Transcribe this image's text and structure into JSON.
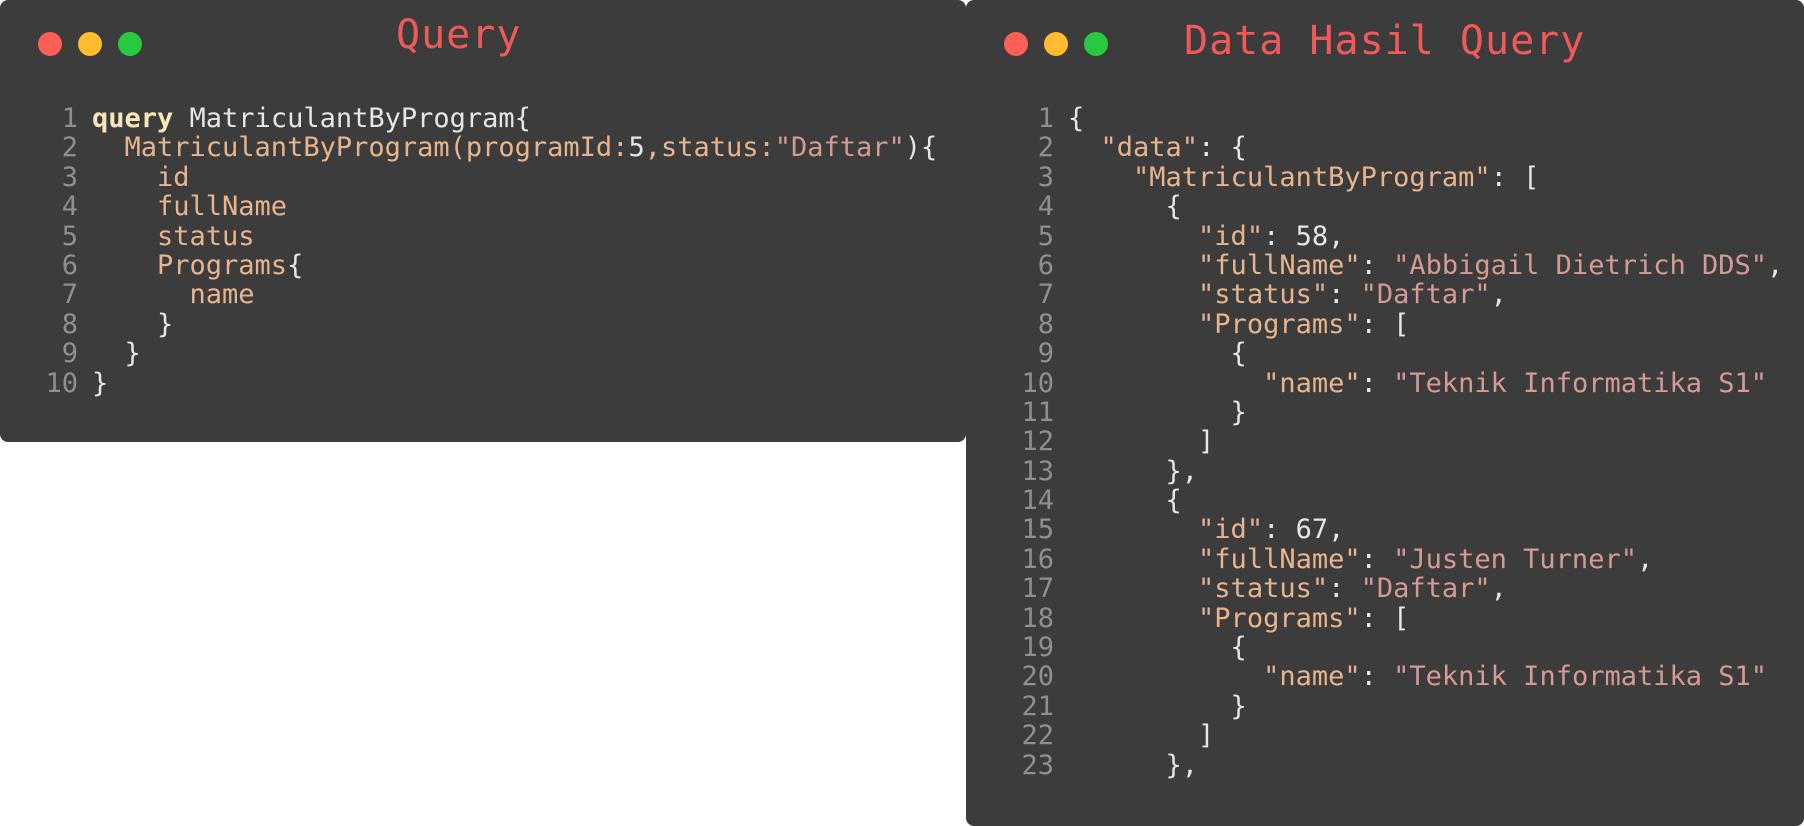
{
  "query_window": {
    "title": "Query",
    "lines": [
      {
        "n": "1",
        "tokens": [
          {
            "t": "query",
            "c": "kw"
          },
          {
            "t": " MatriculantByProgram{",
            "c": "txt"
          }
        ]
      },
      {
        "n": "2",
        "tokens": [
          {
            "t": "  MatriculantByProgram(programId:",
            "c": "fld"
          },
          {
            "t": "5",
            "c": "num"
          },
          {
            "t": ",status:",
            "c": "fld"
          },
          {
            "t": "\"Daftar\"",
            "c": "str"
          },
          {
            "t": "){",
            "c": "txt"
          }
        ]
      },
      {
        "n": "3",
        "tokens": [
          {
            "t": "    id",
            "c": "fld"
          }
        ]
      },
      {
        "n": "4",
        "tokens": [
          {
            "t": "    fullName",
            "c": "fld"
          }
        ]
      },
      {
        "n": "5",
        "tokens": [
          {
            "t": "    status",
            "c": "fld"
          }
        ]
      },
      {
        "n": "6",
        "tokens": [
          {
            "t": "    Programs",
            "c": "fld"
          },
          {
            "t": "{",
            "c": "txt"
          }
        ]
      },
      {
        "n": "7",
        "tokens": [
          {
            "t": "      name",
            "c": "fld"
          }
        ]
      },
      {
        "n": "8",
        "tokens": [
          {
            "t": "    }",
            "c": "txt"
          }
        ]
      },
      {
        "n": "9",
        "tokens": [
          {
            "t": "  }",
            "c": "txt"
          }
        ]
      },
      {
        "n": "10",
        "tokens": [
          {
            "t": "}",
            "c": "txt"
          }
        ]
      }
    ]
  },
  "result_window": {
    "title": "Data Hasil Query",
    "lines": [
      {
        "n": "1",
        "tokens": [
          {
            "t": "{",
            "c": "txt"
          }
        ]
      },
      {
        "n": "2",
        "tokens": [
          {
            "t": "  ",
            "c": "txt"
          },
          {
            "t": "\"data\"",
            "c": "key"
          },
          {
            "t": ": {",
            "c": "txt"
          }
        ]
      },
      {
        "n": "3",
        "tokens": [
          {
            "t": "    ",
            "c": "txt"
          },
          {
            "t": "\"MatriculantByProgram\"",
            "c": "key"
          },
          {
            "t": ": [",
            "c": "txt"
          }
        ]
      },
      {
        "n": "4",
        "tokens": [
          {
            "t": "      {",
            "c": "txt"
          }
        ]
      },
      {
        "n": "5",
        "tokens": [
          {
            "t": "        ",
            "c": "txt"
          },
          {
            "t": "\"id\"",
            "c": "key"
          },
          {
            "t": ": 58,",
            "c": "txt"
          }
        ]
      },
      {
        "n": "6",
        "tokens": [
          {
            "t": "        ",
            "c": "txt"
          },
          {
            "t": "\"fullName\"",
            "c": "key"
          },
          {
            "t": ": ",
            "c": "txt"
          },
          {
            "t": "\"Abbigail Dietrich DDS\"",
            "c": "str"
          },
          {
            "t": ",",
            "c": "txt"
          }
        ]
      },
      {
        "n": "7",
        "tokens": [
          {
            "t": "        ",
            "c": "txt"
          },
          {
            "t": "\"status\"",
            "c": "key"
          },
          {
            "t": ": ",
            "c": "txt"
          },
          {
            "t": "\"Daftar\"",
            "c": "str"
          },
          {
            "t": ",",
            "c": "txt"
          }
        ]
      },
      {
        "n": "8",
        "tokens": [
          {
            "t": "        ",
            "c": "txt"
          },
          {
            "t": "\"Programs\"",
            "c": "key"
          },
          {
            "t": ": [",
            "c": "txt"
          }
        ]
      },
      {
        "n": "9",
        "tokens": [
          {
            "t": "          {",
            "c": "txt"
          }
        ]
      },
      {
        "n": "10",
        "tokens": [
          {
            "t": "            ",
            "c": "txt"
          },
          {
            "t": "\"name\"",
            "c": "key"
          },
          {
            "t": ": ",
            "c": "txt"
          },
          {
            "t": "\"Teknik Informatika S1\"",
            "c": "str"
          }
        ]
      },
      {
        "n": "11",
        "tokens": [
          {
            "t": "          }",
            "c": "txt"
          }
        ]
      },
      {
        "n": "12",
        "tokens": [
          {
            "t": "        ]",
            "c": "txt"
          }
        ]
      },
      {
        "n": "13",
        "tokens": [
          {
            "t": "      },",
            "c": "txt"
          }
        ]
      },
      {
        "n": "14",
        "tokens": [
          {
            "t": "      {",
            "c": "txt"
          }
        ]
      },
      {
        "n": "15",
        "tokens": [
          {
            "t": "        ",
            "c": "txt"
          },
          {
            "t": "\"id\"",
            "c": "key"
          },
          {
            "t": ": 67,",
            "c": "txt"
          }
        ]
      },
      {
        "n": "16",
        "tokens": [
          {
            "t": "        ",
            "c": "txt"
          },
          {
            "t": "\"fullName\"",
            "c": "key"
          },
          {
            "t": ": ",
            "c": "txt"
          },
          {
            "t": "\"Justen Turner\"",
            "c": "str"
          },
          {
            "t": ",",
            "c": "txt"
          }
        ]
      },
      {
        "n": "17",
        "tokens": [
          {
            "t": "        ",
            "c": "txt"
          },
          {
            "t": "\"status\"",
            "c": "key"
          },
          {
            "t": ": ",
            "c": "txt"
          },
          {
            "t": "\"Daftar\"",
            "c": "str"
          },
          {
            "t": ",",
            "c": "txt"
          }
        ]
      },
      {
        "n": "18",
        "tokens": [
          {
            "t": "        ",
            "c": "txt"
          },
          {
            "t": "\"Programs\"",
            "c": "key"
          },
          {
            "t": ": [",
            "c": "txt"
          }
        ]
      },
      {
        "n": "19",
        "tokens": [
          {
            "t": "          {",
            "c": "txt"
          }
        ]
      },
      {
        "n": "20",
        "tokens": [
          {
            "t": "            ",
            "c": "txt"
          },
          {
            "t": "\"name\"",
            "c": "key"
          },
          {
            "t": ": ",
            "c": "txt"
          },
          {
            "t": "\"Teknik Informatika S1\"",
            "c": "str"
          }
        ]
      },
      {
        "n": "21",
        "tokens": [
          {
            "t": "          }",
            "c": "txt"
          }
        ]
      },
      {
        "n": "22",
        "tokens": [
          {
            "t": "        ]",
            "c": "txt"
          }
        ]
      },
      {
        "n": "23",
        "tokens": [
          {
            "t": "      },",
            "c": "txt"
          }
        ]
      }
    ]
  },
  "colors": {
    "window_bg": "#3c3c3c",
    "title": "#f0595a",
    "close": "#fe5f57",
    "minimize": "#febc2e",
    "maximize": "#28c840"
  }
}
